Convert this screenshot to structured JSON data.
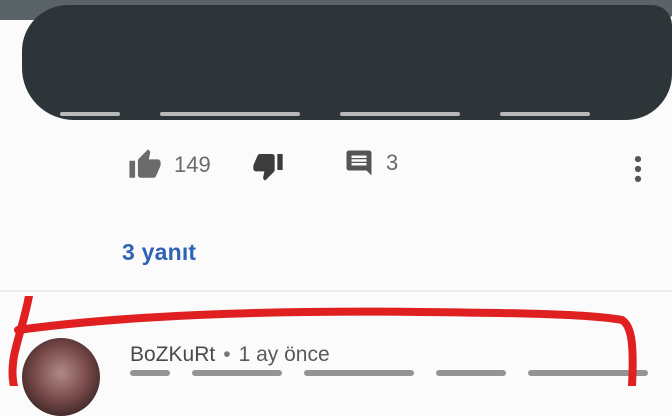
{
  "comment_top": {
    "likes": "149",
    "replies_count": "3"
  },
  "replies_link": "3 yanıt",
  "reply": {
    "author": "BoZKuRt",
    "separator": "•",
    "time": "1 ay önce"
  },
  "colors": {
    "redaction": "#2d3538",
    "link": "#2f63b6",
    "annotation": "#e02020"
  }
}
